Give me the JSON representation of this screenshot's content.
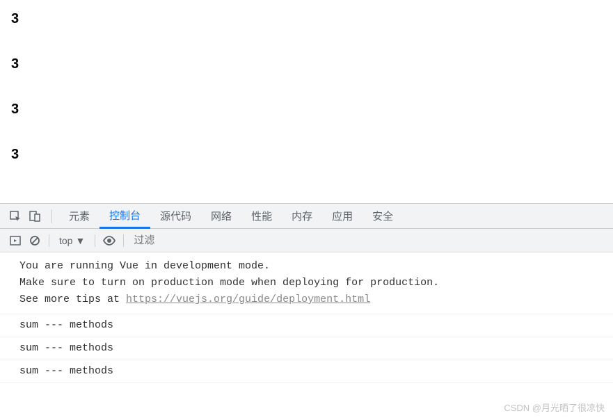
{
  "page": {
    "values": [
      "3",
      "3",
      "3",
      "3"
    ]
  },
  "devtools": {
    "tabs": {
      "elements": "元素",
      "console": "控制台",
      "sources": "源代码",
      "network": "网络",
      "performance": "性能",
      "memory": "内存",
      "application": "应用",
      "security": "安全"
    },
    "activeTab": "console"
  },
  "consoleToolbar": {
    "context": "top",
    "filterPlaceholder": "过滤"
  },
  "console": {
    "vueWarning": {
      "line1": "You are running Vue in development mode.",
      "line2": "Make sure to turn on production mode when deploying for production.",
      "line3Prefix": "See more tips at ",
      "line3Link": "https://vuejs.org/guide/deployment.html"
    },
    "logs": [
      "sum --- methods",
      "sum --- methods",
      "sum --- methods"
    ]
  },
  "watermark": "CSDN @月光晒了很凉快"
}
